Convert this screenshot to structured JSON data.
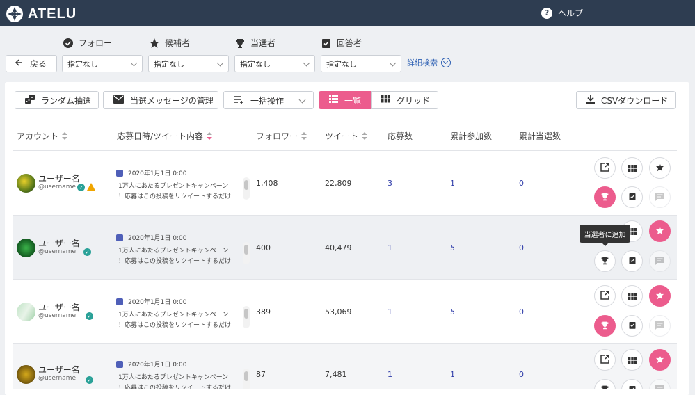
{
  "app": {
    "logo_text": "ATELU",
    "help_label": "ヘルプ"
  },
  "filters": {
    "labels": [
      "フォロー",
      "候補者",
      "当選者",
      "回答者"
    ],
    "back_label": "戻る",
    "selects": [
      "指定なし",
      "指定なし",
      "指定なし",
      "指定なし"
    ],
    "advanced_label": "詳細検索"
  },
  "toolbar": {
    "random_draw": "ランダム抽選",
    "message_manage": "当選メッセージの管理",
    "bulk_action": "一括操作",
    "view_list": "一覧",
    "view_grid": "グリッド",
    "csv_download": "CSVダウンロード"
  },
  "table": {
    "headers": [
      "アカウント",
      "応募日時/ツイート内容",
      "フォロワー",
      "ツイート",
      "応募数",
      "累計参加数",
      "累計当選数"
    ],
    "rows": [
      {
        "name": "ユーザー名",
        "handle": "@username",
        "date": "2020年1月1日 0:00",
        "line1": "1万人にあたるプレゼントキャンペーン",
        "line2": "！応募はこの投稿をリツイートするだけ",
        "followers": "1,408",
        "tweets": "22,809",
        "entries": "3",
        "total_entries": "1",
        "total_wins": "0"
      },
      {
        "name": "ユーザー名",
        "handle": "@username",
        "date": "2020年1月1日 0:00",
        "line1": "1万人にあたるプレゼントキャンペーン",
        "line2": "！応募はこの投稿をリツイートするだけ",
        "followers": "400",
        "tweets": "40,479",
        "entries": "1",
        "total_entries": "5",
        "total_wins": "0"
      },
      {
        "name": "ユーザー名",
        "handle": "@username",
        "date": "2020年1月1日 0:00",
        "line1": "1万人にあたるプレゼントキャンペーン",
        "line2": "！応募はこの投稿をリツイートするだけ",
        "followers": "389",
        "tweets": "53,069",
        "entries": "1",
        "total_entries": "5",
        "total_wins": "0"
      },
      {
        "name": "ユーザー名",
        "handle": "@username",
        "date": "2020年1月1日 0:00",
        "line1": "1万人にあたるプレゼントキャンペーン",
        "line2": "！応募はこの投稿をリツイートするだけ",
        "followers": "87",
        "tweets": "7,481",
        "entries": "1",
        "total_entries": "1",
        "total_wins": "0"
      }
    ]
  },
  "tooltip": {
    "text": "当選者に追加"
  },
  "colors": {
    "accent": "#ec5c8d",
    "header_bg": "#2e3d51",
    "link": "#2c3aa8",
    "verified": "#2aa198",
    "warning": "#f0a500"
  }
}
